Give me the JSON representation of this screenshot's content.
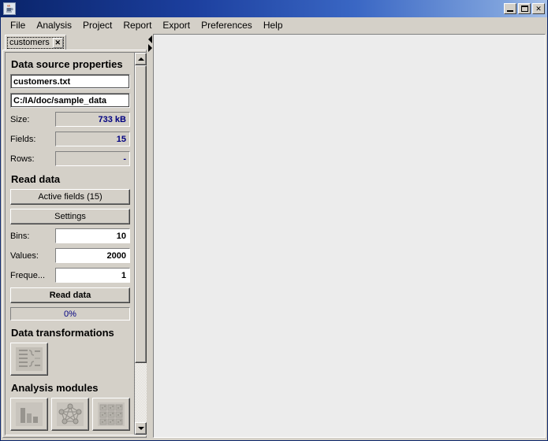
{
  "window": {
    "title": "",
    "app_icon": "java-coffee-cup-icon",
    "controls": {
      "minimize": "minimize-icon",
      "maximize": "maximize-icon",
      "close": "✕"
    }
  },
  "menubar": {
    "items": [
      {
        "label": "File"
      },
      {
        "label": "Analysis"
      },
      {
        "label": "Project"
      },
      {
        "label": "Report"
      },
      {
        "label": "Export"
      },
      {
        "label": "Preferences"
      },
      {
        "label": "Help"
      }
    ]
  },
  "tabs": [
    {
      "label": "customers",
      "close_label": "✕",
      "active": true
    }
  ],
  "panel": {
    "data_source": {
      "heading": "Data source properties",
      "file_name": "customers.txt",
      "file_path": "C:/IA/doc/sample_data",
      "fields": [
        {
          "label": "Size:",
          "value": "733 kB",
          "kind": "readonly"
        },
        {
          "label": "Fields:",
          "value": "15",
          "kind": "readonly"
        },
        {
          "label": "Rows:",
          "value": "-",
          "kind": "blank"
        }
      ]
    },
    "read_data": {
      "heading": "Read data",
      "active_fields_button": "Active fields (15)",
      "settings_button": "Settings",
      "inputs": [
        {
          "label": "Bins:",
          "value": "10"
        },
        {
          "label": "Values:",
          "value": "2000"
        },
        {
          "label": "Freque...",
          "value": "1"
        }
      ],
      "read_button": "Read data",
      "progress_text": "0%",
      "progress_percent": 0
    },
    "data_transformations": {
      "heading": "Data transformations",
      "tiles": [
        {
          "icon": "transform-list-icon",
          "label": ""
        }
      ]
    },
    "analysis_modules": {
      "heading": "Analysis modules",
      "tiles": [
        {
          "icon": "bar-chart-icon",
          "label": ""
        },
        {
          "icon": "network-graph-icon",
          "label": ""
        },
        {
          "icon": "matrix-grid-icon",
          "label": ""
        }
      ]
    }
  },
  "colors": {
    "face": "#d4d0c8",
    "title_start": "#0a246a",
    "title_end": "#a6c0e8",
    "value_text": "#000080",
    "main_background": "#ececec"
  }
}
